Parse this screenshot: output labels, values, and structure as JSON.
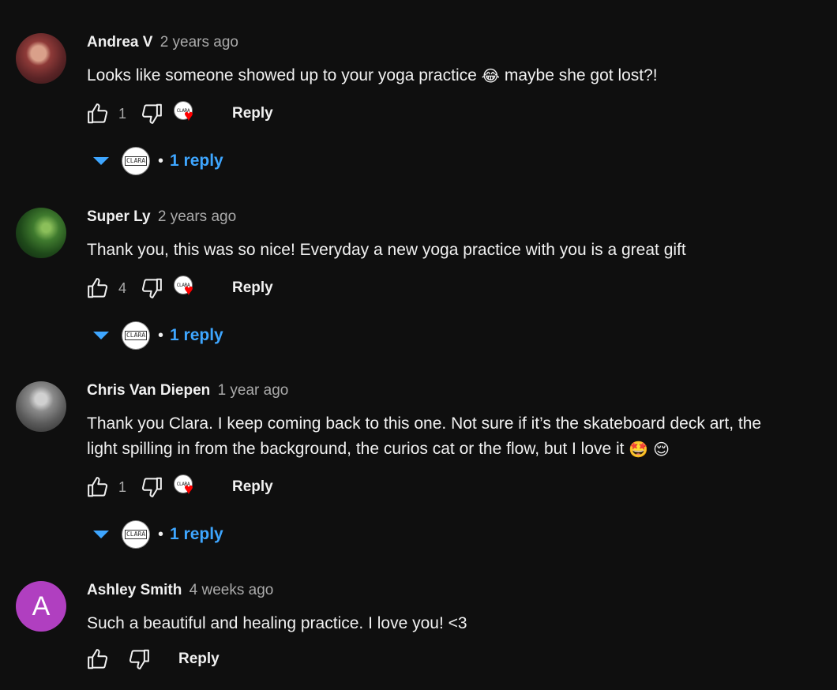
{
  "comments": [
    {
      "author": "Andrea V",
      "time": "2 years ago",
      "text": "Looks like someone showed up to your yoga practice",
      "emoji": "😂",
      "text2": "maybe she got lost?!",
      "likes": "1",
      "reply_label": "Reply",
      "reply_count": "1 reply"
    },
    {
      "author": "Super Ly",
      "time": "2 years ago",
      "text": "Thank you, this was so nice! Everyday a new yoga practice with you is a great gift",
      "likes": "4",
      "reply_label": "Reply",
      "reply_count": "1 reply"
    },
    {
      "author": "Chris Van Diepen",
      "time": "1 year ago",
      "text": "Thank you Clara. I keep coming back to this one. Not sure if it’s the skateboard deck art, the light spilling in from the background, the curios cat or the flow, but I love it",
      "emoji": "🤩",
      "emoji2": "😌",
      "likes": "1",
      "reply_label": "Reply",
      "reply_count": "1 reply"
    },
    {
      "author": "Ashley Smith",
      "avatar_letter": "A",
      "time": "4 weeks ago",
      "text": "Such a beautiful and healing practice. I love you! <3",
      "reply_label": "Reply"
    }
  ],
  "creator_badge": "CLARA",
  "colors": {
    "background": "#0f0f0f",
    "link": "#3ea6ff",
    "heart": "#ff0000",
    "avatar_a": "#b03fc0"
  },
  "icons": [
    "thumb-up-icon",
    "thumb-down-icon",
    "creator-heart-icon",
    "caret-down-icon"
  ]
}
